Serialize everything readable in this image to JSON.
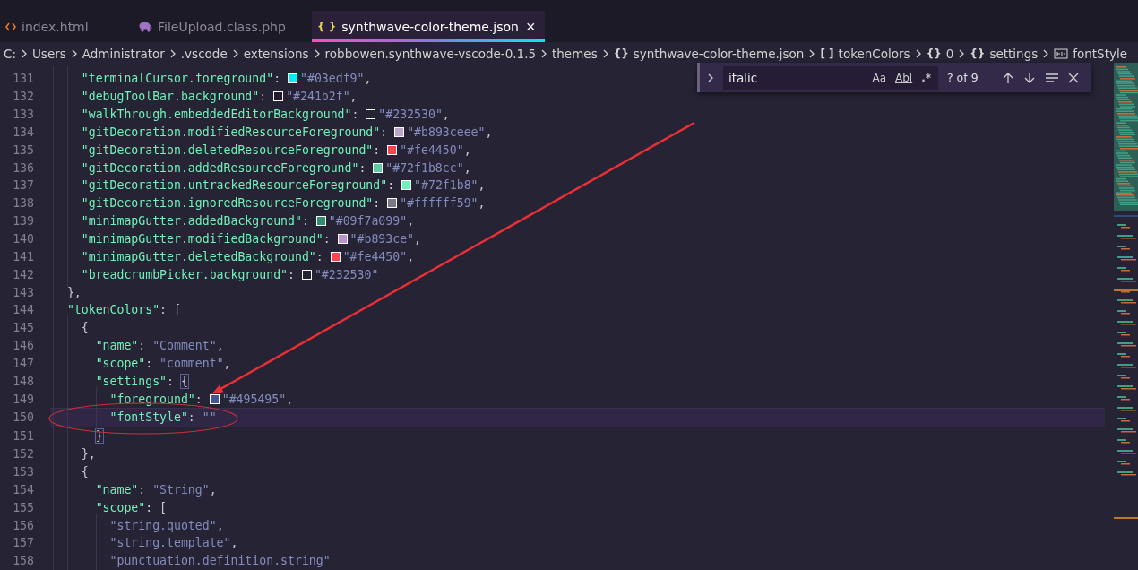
{
  "tabs": [
    {
      "label": "index.html",
      "kind": "html",
      "selected": false
    },
    {
      "label": "FileUpload.class.php",
      "kind": "php",
      "selected": false
    },
    {
      "label": "synthwave-color-theme.json",
      "kind": "json",
      "icon": "{ }",
      "selected": true,
      "close": "×"
    }
  ],
  "breadcrumbs": [
    {
      "label": "C:",
      "kind": "none"
    },
    {
      "label": "Users",
      "kind": "none"
    },
    {
      "label": "Administrator",
      "kind": "none"
    },
    {
      "label": ".vscode",
      "kind": "none"
    },
    {
      "label": "extensions",
      "kind": "none"
    },
    {
      "label": "robbowen.synthwave-vscode-0.1.5",
      "kind": "none"
    },
    {
      "label": "themes",
      "kind": "none"
    },
    {
      "label": "synthwave-color-theme.json",
      "kind": "json",
      "icon": "{}"
    },
    {
      "label": "tokenColors",
      "kind": "array",
      "icon": "[ ]"
    },
    {
      "label": "0",
      "kind": "object",
      "icon": "{}"
    },
    {
      "label": "settings",
      "kind": "object",
      "icon": "{}"
    },
    {
      "label": "fontStyle",
      "kind": "string"
    }
  ],
  "find": {
    "value": "italic",
    "options": [
      "Aa",
      "Abl",
      ".*"
    ],
    "count": "? of 9"
  },
  "lines": [
    {
      "num": "131",
      "current": false,
      "tokens": [
        {
          "kind": "key",
          "text": "    \"terminalCursor.foreground\""
        },
        {
          "kind": "punct",
          "text": ": "
        },
        {
          "kind": "swatch",
          "color": "#03edf9"
        },
        {
          "kind": "value",
          "text": "\"#03edf9\""
        },
        {
          "kind": "punct",
          "text": ","
        }
      ]
    },
    {
      "num": "132",
      "current": false,
      "tokens": [
        {
          "kind": "key",
          "text": "    \"debugToolBar.background\""
        },
        {
          "kind": "punct",
          "text": ": "
        },
        {
          "kind": "swatch",
          "color": "#241b2f"
        },
        {
          "kind": "value",
          "text": "\"#241b2f\""
        },
        {
          "kind": "punct",
          "text": ","
        }
      ]
    },
    {
      "num": "133",
      "current": false,
      "tokens": [
        {
          "kind": "key",
          "text": "    \"walkThrough.embeddedEditorBackground\""
        },
        {
          "kind": "punct",
          "text": ": "
        },
        {
          "kind": "swatch",
          "color": "#232530"
        },
        {
          "kind": "value",
          "text": "\"#232530\""
        },
        {
          "kind": "punct",
          "text": ","
        }
      ]
    },
    {
      "num": "134",
      "current": false,
      "tokens": [
        {
          "kind": "key",
          "text": "    \"gitDecoration.modifiedResourceForeground\""
        },
        {
          "kind": "punct",
          "text": ": "
        },
        {
          "kind": "swatch",
          "color": "#b8a8cc"
        },
        {
          "kind": "value",
          "text": "\"#b893ceee\""
        },
        {
          "kind": "punct",
          "text": ","
        }
      ]
    },
    {
      "num": "135",
      "current": false,
      "tokens": [
        {
          "kind": "key",
          "text": "    \"gitDecoration.deletedResourceForeground\""
        },
        {
          "kind": "punct",
          "text": ": "
        },
        {
          "kind": "swatch",
          "color": "#fe4450"
        },
        {
          "kind": "value",
          "text": "\"#fe4450\""
        },
        {
          "kind": "punct",
          "text": ","
        }
      ]
    },
    {
      "num": "136",
      "current": false,
      "tokens": [
        {
          "kind": "key",
          "text": "    \"gitDecoration.addedResourceForeground\""
        },
        {
          "kind": "punct",
          "text": ": "
        },
        {
          "kind": "swatch",
          "color": "#62c9a0"
        },
        {
          "kind": "value",
          "text": "\"#72f1b8cc\""
        },
        {
          "kind": "punct",
          "text": ","
        }
      ]
    },
    {
      "num": "137",
      "current": false,
      "tokens": [
        {
          "kind": "key",
          "text": "    \"gitDecoration.untrackedResourceForeground\""
        },
        {
          "kind": "punct",
          "text": ": "
        },
        {
          "kind": "swatch",
          "color": "#72f1b8"
        },
        {
          "kind": "value",
          "text": "\"#72f1b8\""
        },
        {
          "kind": "punct",
          "text": ","
        }
      ]
    },
    {
      "num": "138",
      "current": false,
      "tokens": [
        {
          "kind": "key",
          "text": "    \"gitDecoration.ignoredResourceForeground\""
        },
        {
          "kind": "punct",
          "text": ": "
        },
        {
          "kind": "swatch",
          "color": "#7d7885"
        },
        {
          "kind": "value",
          "text": "\"#ffffff59\""
        },
        {
          "kind": "punct",
          "text": ","
        }
      ]
    },
    {
      "num": "139",
      "current": false,
      "tokens": [
        {
          "kind": "key",
          "text": "    \"minimapGutter.addedBackground\""
        },
        {
          "kind": "punct",
          "text": ": "
        },
        {
          "kind": "swatch",
          "color": "#2e8e70"
        },
        {
          "kind": "value",
          "text": "\"#09f7a099\""
        },
        {
          "kind": "punct",
          "text": ","
        }
      ]
    },
    {
      "num": "140",
      "current": false,
      "tokens": [
        {
          "kind": "key",
          "text": "    \"minimapGutter.modifiedBackground\""
        },
        {
          "kind": "punct",
          "text": ": "
        },
        {
          "kind": "swatch",
          "color": "#b893ce"
        },
        {
          "kind": "value",
          "text": "\"#b893ce\""
        },
        {
          "kind": "punct",
          "text": ","
        }
      ]
    },
    {
      "num": "141",
      "current": false,
      "tokens": [
        {
          "kind": "key",
          "text": "    \"minimapGutter.deletedBackground\""
        },
        {
          "kind": "punct",
          "text": ": "
        },
        {
          "kind": "swatch",
          "color": "#fe4450"
        },
        {
          "kind": "value",
          "text": "\"#fe4450\""
        },
        {
          "kind": "punct",
          "text": ","
        }
      ]
    },
    {
      "num": "142",
      "current": false,
      "tokens": [
        {
          "kind": "key",
          "text": "    \"breadcrumbPicker.background\""
        },
        {
          "kind": "punct",
          "text": ": "
        },
        {
          "kind": "swatch",
          "color": "#232530"
        },
        {
          "kind": "value",
          "text": "\"#232530\""
        }
      ]
    },
    {
      "num": "143",
      "current": false,
      "tokens": [
        {
          "kind": "punct",
          "text": "  },"
        }
      ]
    },
    {
      "num": "144",
      "current": false,
      "tokens": [
        {
          "kind": "key",
          "text": "  \"tokenColors\""
        },
        {
          "kind": "punct",
          "text": ": ["
        }
      ]
    },
    {
      "num": "145",
      "current": false,
      "tokens": [
        {
          "kind": "punct",
          "text": "    {"
        }
      ]
    },
    {
      "num": "146",
      "current": false,
      "tokens": [
        {
          "kind": "key",
          "text": "      \"name\""
        },
        {
          "kind": "punct",
          "text": ": "
        },
        {
          "kind": "value",
          "text": "\"Comment\""
        },
        {
          "kind": "punct",
          "text": ","
        }
      ]
    },
    {
      "num": "147",
      "current": false,
      "tokens": [
        {
          "kind": "key",
          "text": "      \"scope\""
        },
        {
          "kind": "punct",
          "text": ": "
        },
        {
          "kind": "value",
          "text": "\"comment\""
        },
        {
          "kind": "punct",
          "text": ","
        }
      ]
    },
    {
      "num": "148",
      "current": false,
      "tokens": [
        {
          "kind": "key",
          "text": "      \"settings\""
        },
        {
          "kind": "punct",
          "text": ": "
        },
        {
          "kind": "match",
          "text": "{"
        }
      ]
    },
    {
      "num": "149",
      "current": false,
      "tokens": [
        {
          "kind": "key",
          "text": "        \"foreground\""
        },
        {
          "kind": "punct",
          "text": ": "
        },
        {
          "kind": "swatch",
          "color": "#495495"
        },
        {
          "kind": "value",
          "text": "\"#495495\""
        },
        {
          "kind": "punct",
          "text": ","
        }
      ]
    },
    {
      "num": "150",
      "current": true,
      "tokens": [
        {
          "kind": "key",
          "text": "        \"fontStyle\""
        },
        {
          "kind": "punct",
          "text": ": "
        },
        {
          "kind": "value",
          "text": "\"\""
        }
      ]
    },
    {
      "num": "151",
      "current": false,
      "tokens": [
        {
          "kind": "match",
          "text": "      }"
        }
      ]
    },
    {
      "num": "152",
      "current": false,
      "tokens": [
        {
          "kind": "punct",
          "text": "    },"
        }
      ]
    },
    {
      "num": "153",
      "current": false,
      "tokens": [
        {
          "kind": "punct",
          "text": "    {"
        }
      ]
    },
    {
      "num": "154",
      "current": false,
      "tokens": [
        {
          "kind": "key",
          "text": "      \"name\""
        },
        {
          "kind": "punct",
          "text": ": "
        },
        {
          "kind": "value",
          "text": "\"String\""
        },
        {
          "kind": "punct",
          "text": ","
        }
      ]
    },
    {
      "num": "155",
      "current": false,
      "tokens": [
        {
          "kind": "key",
          "text": "      \"scope\""
        },
        {
          "kind": "punct",
          "text": ": ["
        }
      ]
    },
    {
      "num": "156",
      "current": false,
      "tokens": [
        {
          "kind": "value",
          "text": "        \"string.quoted\""
        },
        {
          "kind": "punct",
          "text": ","
        }
      ]
    },
    {
      "num": "157",
      "current": false,
      "tokens": [
        {
          "kind": "value",
          "text": "        \"string.template\""
        },
        {
          "kind": "punct",
          "text": ","
        }
      ]
    },
    {
      "num": "158",
      "current": false,
      "tokens": [
        {
          "kind": "value",
          "text": "        \"punctuation.definition.string\""
        }
      ]
    }
  ]
}
